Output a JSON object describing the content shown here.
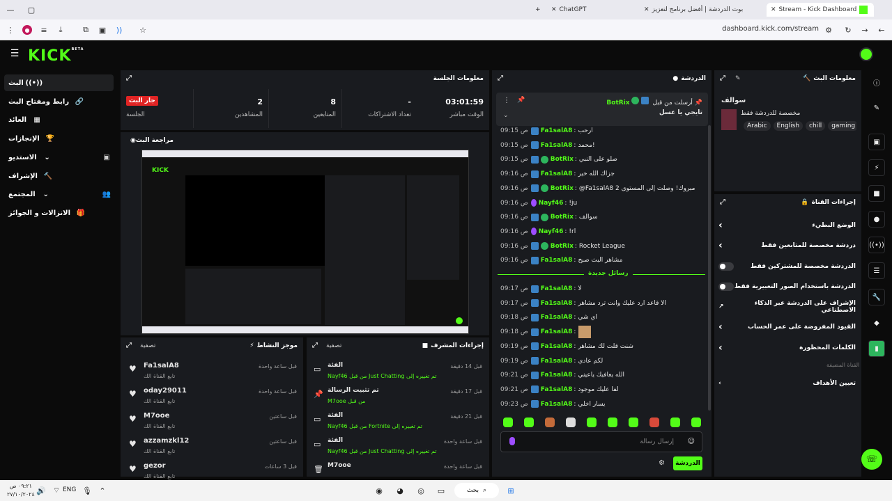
{
  "browser": {
    "tabs": [
      {
        "title": "Stream - Kick Dashboard",
        "active": true
      },
      {
        "title": "بوت الدردشة | أفضل برنامج لتعزيز",
        "active": false
      },
      {
        "title": "ChatGPT",
        "active": false
      }
    ],
    "url": "dashboard.kick.com/stream"
  },
  "header": {
    "logo": "KICK",
    "logo_beta": "BETA"
  },
  "sidebar": {
    "items": [
      {
        "label": "البث",
        "icon": "broadcast-icon"
      },
      {
        "label": "رابط ومفتاح البث",
        "icon": "link-icon"
      },
      {
        "label": "العائد",
        "icon": "chart-icon"
      },
      {
        "label": "الإنجازات",
        "icon": "trophy-icon"
      },
      {
        "label": "الاستديو",
        "icon": "chevron-down-icon"
      },
      {
        "label": "الإشراف",
        "icon": "hammer-icon"
      },
      {
        "label": "المجتمع",
        "icon": "chevron-down-icon"
      },
      {
        "label": "الانزالات و الجوائز",
        "icon": "gift-icon"
      }
    ]
  },
  "session": {
    "title": "معلومات الجلسة",
    "stats": [
      {
        "label": "الوقت مباشر",
        "value": "03:01:59"
      },
      {
        "label": "تعداد الاشتراكات",
        "value": "-"
      },
      {
        "label": "المتابعين",
        "value": "8"
      },
      {
        "label": "المشاهدين",
        "value": "2"
      },
      {
        "label": "الجلسة",
        "value": "جار البث"
      }
    ]
  },
  "preview": {
    "title": "مراجعة البث"
  },
  "activity": {
    "title": "موجز النشاط",
    "filter": "تصفية",
    "items": [
      {
        "name": "Fa1salA8",
        "sub": "تابع القناة الك",
        "time": "قبل ساعة واحدة"
      },
      {
        "name": "oday29011",
        "sub": "تابع القناة الك",
        "time": "قبل ساعة واحدة"
      },
      {
        "name": "M7ooe",
        "sub": "تابع القناة الك",
        "time": "قبل ساعتين"
      },
      {
        "name": "azzamzkl12",
        "sub": "تابع القناة الك",
        "time": "قبل ساعتين"
      },
      {
        "name": "gezor",
        "sub": "تابع القناة الك",
        "time": "قبل 3 ساعات"
      }
    ]
  },
  "modactions": {
    "title": "إجراءات المشرف",
    "filter": "تصفية",
    "items": [
      {
        "title": "الفئة",
        "detail": "تم تغييره إلى Just Chatting من قبل Nayf46",
        "time": "قبل 14 دقيقة",
        "icon": "category-icon"
      },
      {
        "title": "تم تثبيت الرسالة",
        "detail": "من قبل M7ooe",
        "time": "قبل 17 دقيقة",
        "icon": "pin-icon"
      },
      {
        "title": "الفئة",
        "detail": "تم تغييره إلى Fortnite من قبل Nayf46",
        "time": "قبل 21 دقيقة",
        "icon": "category-icon"
      },
      {
        "title": "الفئة",
        "detail": "تم تغييره إلى Just Chatting من قبل Nayf46",
        "time": "قبل ساعة واحدة",
        "icon": "category-icon"
      },
      {
        "title": "M7ooe",
        "detail": "",
        "time": "قبل ساعة واحدة",
        "icon": "trash-icon"
      }
    ]
  },
  "chat": {
    "title": "الدردشة",
    "pinned": {
      "user": "BotRix",
      "by": "أرسلت من قبل",
      "text": "تايجي يا عسل"
    },
    "messages": [
      {
        "time": "09:15 ص",
        "user": "Fa1salA8",
        "color": "#53fc18",
        "badge": "blue",
        "text": "ارحب"
      },
      {
        "time": "09:15 ص",
        "user": "Fa1salA8",
        "color": "#53fc18",
        "badge": "blue",
        "text": "محمد!"
      },
      {
        "time": "09:15 ص",
        "user": "BotRix",
        "color": "#53fc18",
        "badge": "botrix",
        "text": "صلو على النبي"
      },
      {
        "time": "09:16 ص",
        "user": "Fa1salA8",
        "color": "#53fc18",
        "badge": "blue",
        "text": "جزاك الله خير"
      },
      {
        "time": "09:16 ص",
        "user": "BotRix",
        "color": "#53fc18",
        "badge": "botrix",
        "text": "@Fa1salA8 مبروك! وصلت إلى المستوى 2"
      },
      {
        "time": "09:16 ص",
        "user": "Nayf46",
        "color": "#53fc18",
        "badge": "purple",
        "text": "!ju"
      },
      {
        "time": "09:16 ص",
        "user": "BotRix",
        "color": "#53fc18",
        "badge": "botrix",
        "text": "سوالف"
      },
      {
        "time": "09:16 ص",
        "user": "Nayf46",
        "color": "#53fc18",
        "badge": "purple",
        "text": "!rl"
      },
      {
        "time": "09:16 ص",
        "user": "BotRix",
        "color": "#53fc18",
        "badge": "botrix",
        "text": "Rocket League"
      },
      {
        "time": "09:16 ص",
        "user": "Fa1salA8",
        "color": "#53fc18",
        "badge": "blue",
        "text": "مشاهر البث صبح"
      }
    ],
    "new_messages_label": "رسائل جديدة",
    "messages2": [
      {
        "time": "09:17 ص",
        "user": "Fa1salA8",
        "color": "#53fc18",
        "badge": "blue",
        "text": "لا"
      },
      {
        "time": "09:17 ص",
        "user": "Fa1salA8",
        "color": "#53fc18",
        "badge": "blue",
        "text": "الا قاعد ارد عليك وانت ترد مشاهر"
      },
      {
        "time": "09:18 ص",
        "user": "Fa1salA8",
        "color": "#53fc18",
        "badge": "blue",
        "text": "اي شي"
      },
      {
        "time": "09:18 ص",
        "user": "Fa1salA8",
        "color": "#53fc18",
        "badge": "blue",
        "text": ""
      },
      {
        "time": "09:19 ص",
        "user": "Fa1salA8",
        "color": "#53fc18",
        "badge": "blue",
        "text": "شنت قلت لك مشاهر"
      },
      {
        "time": "09:19 ص",
        "user": "Fa1salA8",
        "color": "#53fc18",
        "badge": "blue",
        "text": "لكم عادي"
      },
      {
        "time": "09:21 ص",
        "user": "Fa1salA8",
        "color": "#53fc18",
        "badge": "blue",
        "text": "الله يعافيك ياعيني"
      },
      {
        "time": "09:21 ص",
        "user": "Fa1salA8",
        "color": "#53fc18",
        "badge": "blue",
        "text": "لفا عليك موجود"
      },
      {
        "time": "09:23 ص",
        "user": "Fa1salA8",
        "color": "#53fc18",
        "badge": "blue",
        "text": "يسار اخلي"
      }
    ],
    "input_placeholder": "إرسال رسالة",
    "send_label": "الدردشة"
  },
  "streaminfo": {
    "title": "معلومات البث",
    "stream_title": "سوالف",
    "category": "مخصصة للدردشة فقط",
    "tags": [
      "Arabic",
      "English",
      "chill",
      "gaming"
    ]
  },
  "channel": {
    "title": "إجراءات القناة",
    "actions": [
      {
        "label": "الوضع البطيء",
        "control": "arrow"
      },
      {
        "label": "دردشة مخصصة للمتابعين فقط",
        "control": "arrow"
      },
      {
        "label": "الدردشة مخصصة للمشتركين فقط",
        "control": "toggle"
      },
      {
        "label": "الدردشة باستخدام الصور التعبيرية فقط",
        "control": "toggle"
      },
      {
        "label": "الإشراف على الدردشة عبر الذكاء الاصطناعي",
        "control": "external"
      },
      {
        "label": "القيود المفروضة على عمر الحساب",
        "control": "arrow"
      },
      {
        "label": "الكلمات المحظورة",
        "control": "arrow"
      }
    ],
    "section_label": "القناة المضيفة",
    "goals_label": "تعيين الأهداف"
  },
  "taskbar": {
    "search": "بحث",
    "lang": "ENG",
    "time": "٠٩:٢١ ص",
    "date": "٢٧/١٠/٢٠٢٤"
  },
  "colors": {
    "accent": "#53fc18",
    "panel": "#191b1f",
    "bg": "#0b0b0b",
    "live": "#e02424"
  }
}
